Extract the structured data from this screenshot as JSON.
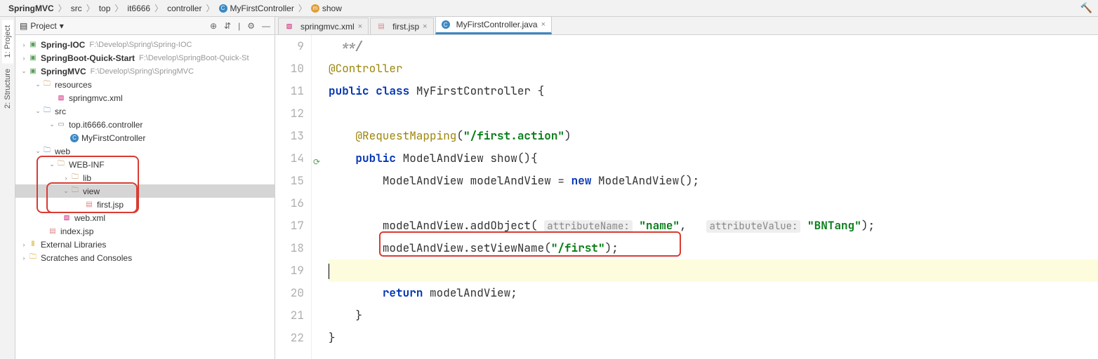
{
  "breadcrumb": [
    {
      "label": "SpringMVC",
      "bold": true
    },
    {
      "label": "src"
    },
    {
      "label": "top"
    },
    {
      "label": "it6666"
    },
    {
      "label": "controller"
    },
    {
      "label": "MyFirstController",
      "icon": "c"
    },
    {
      "label": "show",
      "icon": "m"
    }
  ],
  "side_tabs": {
    "project": "1: Project",
    "structure": "2: Structure"
  },
  "project_panel": {
    "title": "Project",
    "icons": {
      "target": "⊕",
      "collapse": "⇵",
      "divider": "|",
      "gear": "⚙",
      "hide": "—"
    }
  },
  "tree": {
    "r0": {
      "name": "Spring-IOC",
      "hint": "F:\\Develop\\Spring\\Spring-IOC"
    },
    "r1": {
      "name": "SpringBoot-Quick-Start",
      "hint": "F:\\Develop\\SpringBoot-Quick-St"
    },
    "r2": {
      "name": "SpringMVC",
      "hint": "F:\\Develop\\Spring\\SpringMVC"
    },
    "r3": {
      "name": "resources"
    },
    "r4": {
      "name": "springmvc.xml"
    },
    "r5": {
      "name": "src"
    },
    "r6": {
      "name": "top.it6666.controller"
    },
    "r7": {
      "name": "MyFirstController"
    },
    "r8": {
      "name": "web"
    },
    "r9": {
      "name": "WEB-INF"
    },
    "r10": {
      "name": "lib"
    },
    "r11": {
      "name": "view"
    },
    "r12": {
      "name": "first.jsp"
    },
    "r13": {
      "name": "web.xml"
    },
    "r14": {
      "name": "index.jsp"
    },
    "r15": {
      "name": "External Libraries"
    },
    "r16": {
      "name": "Scratches and Consoles"
    }
  },
  "tabs": [
    {
      "label": "springmvc.xml"
    },
    {
      "label": "first.jsp"
    },
    {
      "label": "MyFirstController.java"
    }
  ],
  "code": {
    "lines": [
      "9",
      "10",
      "11",
      "12",
      "13",
      "14",
      "15",
      "16",
      "17",
      "18",
      "19",
      "20",
      "21",
      "22"
    ],
    "l9": "**/",
    "l10_ann": "@Controller",
    "l11_pub": "public",
    "l11_cls": "class",
    "l11_name": " MyFirstController {",
    "l13_ann": "@RequestMapping",
    "l13_par": "(",
    "l13_str": "\"/first.action\"",
    "l13_end": ")",
    "l14_pub": "public",
    "l14_rest": " ModelAndView show(){",
    "l15": "ModelAndView modelAndView = ",
    "l15_new": "new",
    "l15_end": " ModelAndView();",
    "l17a": "modelAndView.addObject( ",
    "l17h1": "attributeName:",
    "l17s1": " \"name\"",
    "l17c": ",   ",
    "l17h2": "attributeValue:",
    "l17s2": " \"BNTang\"",
    "l17e": ");",
    "l18a": "modelAndView.setViewName(",
    "l18s": "\"/first\"",
    "l18e": ");",
    "l20_ret": "return",
    "l20e": " modelAndView;",
    "l21": "}",
    "l22": "}"
  }
}
